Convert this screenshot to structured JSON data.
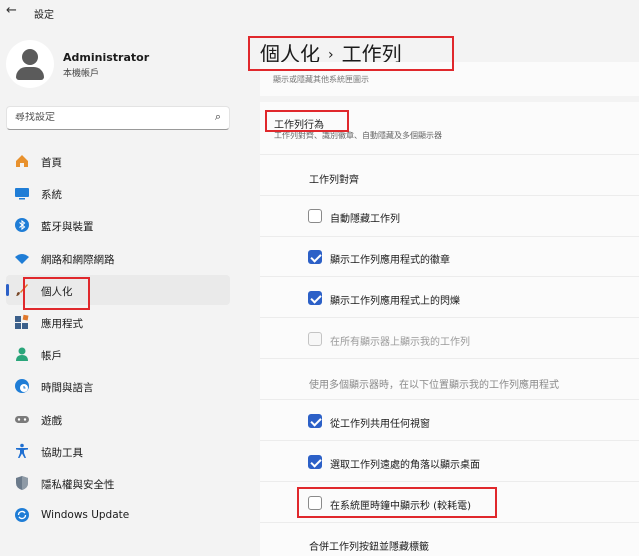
{
  "window": {
    "back_glyph": "←",
    "title": "設定"
  },
  "user": {
    "name": "Administrator",
    "account_type": "本機帳戶"
  },
  "search": {
    "placeholder": "尋找設定",
    "icon": "search-icon"
  },
  "nav": [
    {
      "label": "首頁",
      "icon": "home-icon",
      "color": "#e8912d"
    },
    {
      "label": "系統",
      "icon": "system-icon",
      "color": "#1f7dd6"
    },
    {
      "label": "藍牙與裝置",
      "icon": "bluetooth-icon",
      "color": "#1f7dd6"
    },
    {
      "label": "網路和網際網路",
      "icon": "wifi-icon",
      "color": "#1f7dd6"
    },
    {
      "label": "個人化",
      "icon": "brush-icon",
      "color": "#e0782c",
      "active": true
    },
    {
      "label": "應用程式",
      "icon": "apps-icon",
      "color": "#3b5f8a"
    },
    {
      "label": "帳戶",
      "icon": "account-icon",
      "color": "#2aa57a"
    },
    {
      "label": "時間與語言",
      "icon": "globe-clock-icon",
      "color": "#1f7dd6"
    },
    {
      "label": "遊戲",
      "icon": "gamepad-icon",
      "color": "#7a7a7a"
    },
    {
      "label": "協助工具",
      "icon": "accessibility-icon",
      "color": "#1f6fd1"
    },
    {
      "label": "隱私權與安全性",
      "icon": "shield-icon",
      "color": "#6b7a8a"
    },
    {
      "label": "Windows Update",
      "icon": "update-icon",
      "color": "#1f7dd6"
    }
  ],
  "main": {
    "breadcrumb_parent": "個人化",
    "breadcrumb_sep": "›",
    "breadcrumb_current": "工作列",
    "faint_text": "顯示或隱藏其他系統匣圖示",
    "behaviors_title": "工作列行為",
    "behaviors_subtitle": "工作列對齊、識別徽章、自動隱藏及多個顯示器",
    "alignment_label": "工作列對齊",
    "options": [
      {
        "label": "自動隱藏工作列",
        "checked": false,
        "disabled": false
      },
      {
        "label": "顯示工作列應用程式的徽章",
        "checked": true,
        "disabled": false
      },
      {
        "label": "顯示工作列應用程式上的閃爍",
        "checked": true,
        "disabled": false
      },
      {
        "label": "在所有顯示器上顯示我的工作列",
        "checked": false,
        "disabled": true
      }
    ],
    "multi_display_label": "使用多個顯示器時，在以下位置顯示我的工作列應用程式",
    "options2": [
      {
        "label": "從工作列共用任何視窗",
        "checked": true,
        "disabled": false
      },
      {
        "label": "選取工作列遠處的角落以顯示桌面",
        "checked": true,
        "disabled": false
      },
      {
        "label": "在系統匣時鐘中顯示秒 (較耗電)",
        "checked": false,
        "disabled": false
      }
    ],
    "combine_label": "合併工作列按鈕並隱藏標籤"
  },
  "colors": {
    "accent": "#2c60c7",
    "highlight": "#e0282c"
  }
}
